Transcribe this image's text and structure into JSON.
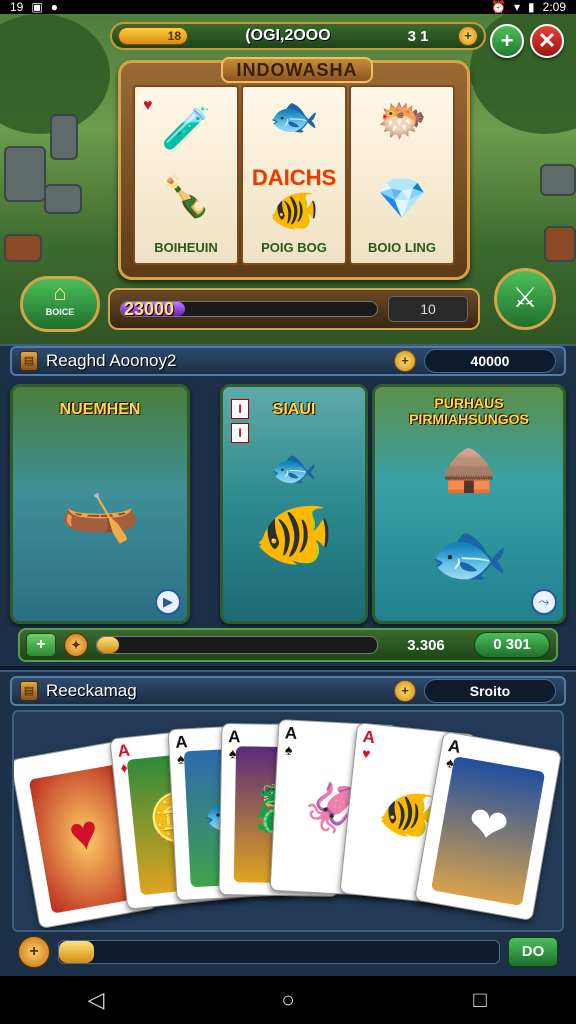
{
  "status_bar": {
    "time_left": "19",
    "time_right": "2:09"
  },
  "top_bar": {
    "coin_value": "18",
    "score": "(OGI,2OOO",
    "level": "3  1",
    "plus_label": "+",
    "close_label": "✕"
  },
  "slot_machine": {
    "title": "INDOWASHA",
    "reels": [
      {
        "label": "BOIHEUIN"
      },
      {
        "label": "POIG BOG",
        "middle_text": "DAICHS"
      },
      {
        "label": "BOIO LING"
      }
    ],
    "home_label": "BOICE",
    "balance": "23000",
    "balance_progress": 0.25,
    "right_value": "10"
  },
  "mode_panel": {
    "title": "Reaghd Aoonoy2",
    "value": "40000",
    "tiles": [
      {
        "title": "NUEMHEN"
      },
      {
        "title": "SIAUI"
      },
      {
        "title": "PURHAUS PIRMIAHSUNGOS"
      }
    ],
    "bar_progress": 0.08,
    "bar_number": "3.306",
    "bar_pill": "0 301"
  },
  "cards_panel": {
    "title": "Reeckamag",
    "value": "Sroito",
    "cards": [
      {
        "rank": "",
        "suit": "",
        "color": "red"
      },
      {
        "rank": "A",
        "suit": "♦",
        "color": "red"
      },
      {
        "rank": "A",
        "suit": "♠",
        "color": "black"
      },
      {
        "rank": "A",
        "suit": "♠",
        "color": "black"
      },
      {
        "rank": "A",
        "suit": "♠",
        "color": "black"
      },
      {
        "rank": "A",
        "suit": "♥",
        "color": "red"
      },
      {
        "rank": "A",
        "suit": "♠",
        "color": "black"
      }
    ],
    "bar_progress": 0.08,
    "pill": "DO"
  },
  "colors": {
    "accent_gold": "#d8a24b",
    "panel_blue": "#1c3048",
    "green": "#4cbf5a"
  }
}
